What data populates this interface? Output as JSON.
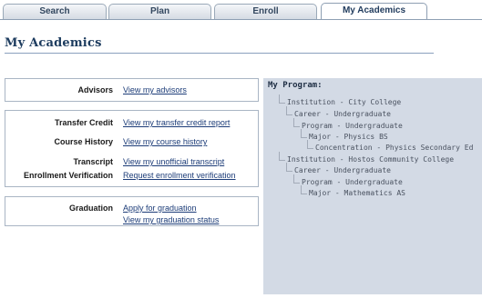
{
  "tabs": [
    "Search",
    "Plan",
    "Enroll",
    "My Academics"
  ],
  "page": {
    "title": "My Academics"
  },
  "advisors": {
    "label": "Advisors",
    "link": "View my advisors"
  },
  "records": {
    "transfer_credit": {
      "label": "Transfer Credit",
      "link": "View my transfer credit report"
    },
    "course_history": {
      "label": "Course History",
      "link": "View my course history"
    },
    "transcript": {
      "label": "Transcript",
      "link": "View my unofficial transcript"
    },
    "enrollment_verification": {
      "label": "Enrollment Verification",
      "link": "Request enrollment verification"
    }
  },
  "graduation": {
    "label": "Graduation",
    "links": [
      "Apply for graduation",
      "View my graduation status"
    ]
  },
  "program": {
    "title": "My Program:",
    "items": [
      "Institution - City College",
      "Career - Undergraduate",
      "Program - Undergraduate",
      "Major - Physics BS",
      "Concentration - Physics Secondary Ed",
      "Institution - Hostos Community College",
      "Career - Undergraduate",
      "Program - Undergraduate",
      "Major - Mathematics AS"
    ]
  }
}
